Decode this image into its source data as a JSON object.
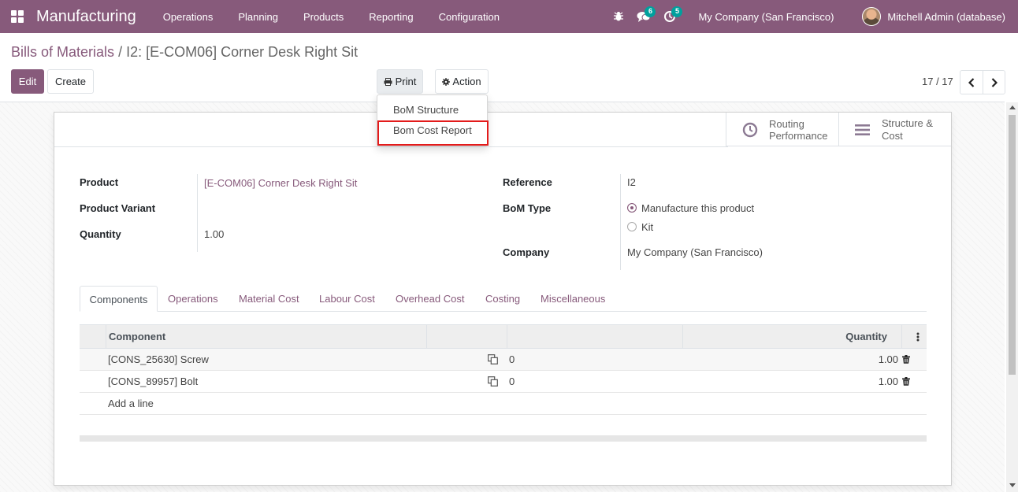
{
  "app": {
    "title": "Manufacturing",
    "menu": [
      "Operations",
      "Planning",
      "Products",
      "Reporting",
      "Configuration"
    ],
    "messages_badge": "6",
    "activities_badge": "5",
    "company": "My Company (San Francisco)",
    "user": "Mitchell Admin (database)",
    "accent_color": "#875a7b"
  },
  "breadcrumb": {
    "parent": "Bills of Materials",
    "separator": "/",
    "current": "I2: [E-COM06] Corner Desk Right Sit"
  },
  "toolbar": {
    "edit_label": "Edit",
    "create_label": "Create",
    "print_label": "Print",
    "action_label": "Action",
    "pager": "17 / 17"
  },
  "print_menu": {
    "items": [
      "BoM Structure",
      "Bom Cost Report"
    ],
    "highlighted_item": "Bom Cost Report"
  },
  "smart_buttons": {
    "routing_line1": "Routing",
    "routing_line2": "Performance",
    "structure_line1": "Structure &",
    "structure_line2": "Cost"
  },
  "form": {
    "product_label": "Product",
    "product_value": "[E-COM06] Corner Desk Right Sit",
    "variant_label": "Product Variant",
    "variant_value": "",
    "quantity_label": "Quantity",
    "quantity_value": "1.00",
    "reference_label": "Reference",
    "reference_value": "I2",
    "bom_type_label": "BoM Type",
    "bom_type_options": [
      "Manufacture this product",
      "Kit"
    ],
    "bom_type_selected": "Manufacture this product",
    "company_label": "Company",
    "company_value": "My Company (San Francisco)"
  },
  "tabs": [
    "Components",
    "Operations",
    "Material Cost",
    "Labour Cost",
    "Overhead Cost",
    "Costing",
    "Miscellaneous"
  ],
  "active_tab": "Components",
  "components_table": {
    "headers": {
      "component": "Component",
      "quantity": "Quantity"
    },
    "rows": [
      {
        "component": "[CONS_25630] Screw",
        "count": "0",
        "quantity": "1.00"
      },
      {
        "component": "[CONS_89957] Bolt",
        "count": "0",
        "quantity": "1.00"
      }
    ],
    "add_line": "Add a line"
  }
}
